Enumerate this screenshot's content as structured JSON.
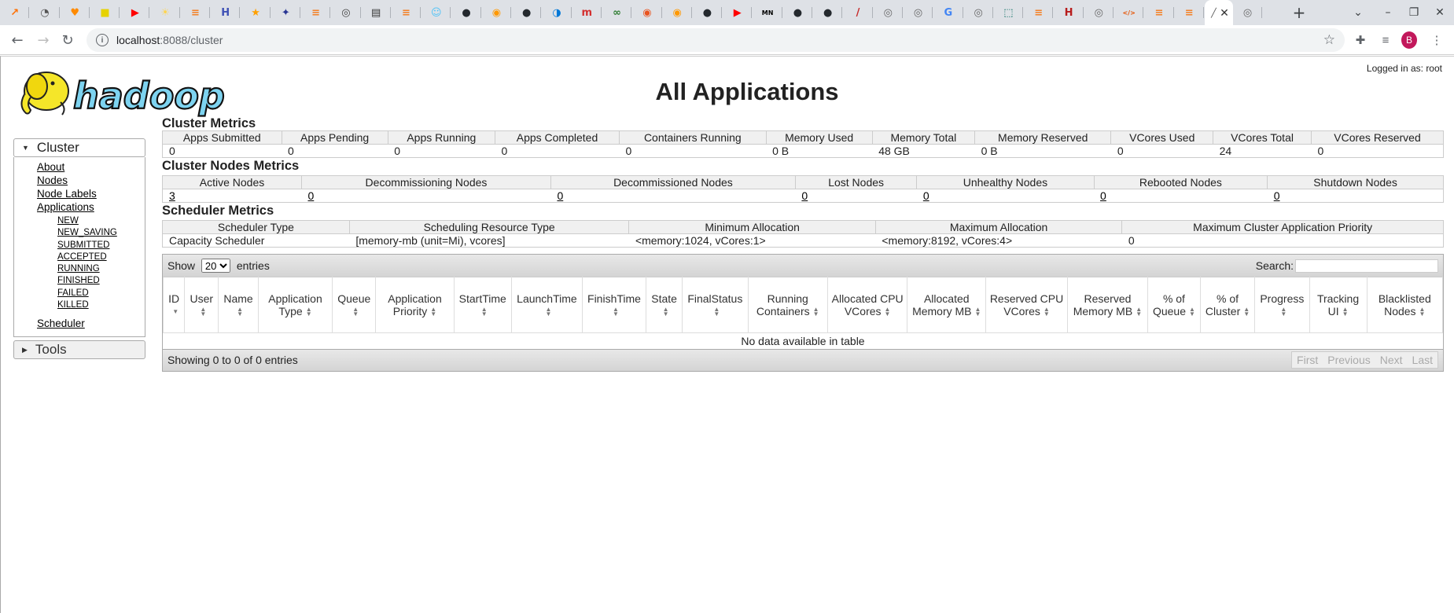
{
  "browser": {
    "tabs": [
      {
        "icon": "hue-icon",
        "color": "#ff6f00",
        "glyph": "↗"
      },
      {
        "icon": "clock-icon",
        "color": "#555555",
        "glyph": "◔"
      },
      {
        "icon": "heart-icon",
        "color": "#ff8a00",
        "glyph": "♥"
      },
      {
        "icon": "yellow-square-icon",
        "color": "#e6d200",
        "glyph": "■"
      },
      {
        "icon": "youtube-icon",
        "color": "#ff0000",
        "glyph": "▶"
      },
      {
        "icon": "bulb-icon",
        "color": "#ffd54f",
        "glyph": "☀"
      },
      {
        "icon": "stackoverflow-icon",
        "color": "#f48024",
        "glyph": "≡"
      },
      {
        "icon": "bracket-icon",
        "color": "#3f51b5",
        "glyph": "H"
      },
      {
        "icon": "trophy-icon",
        "color": "#ffa000",
        "glyph": "★"
      },
      {
        "icon": "grid-icon",
        "color": "#283593",
        "glyph": "✦"
      },
      {
        "icon": "stackoverflow-icon",
        "color": "#f48024",
        "glyph": "≡"
      },
      {
        "icon": "chrome-icon",
        "color": "#444444",
        "glyph": "◎"
      },
      {
        "icon": "doc-icon",
        "color": "#333333",
        "glyph": "▤"
      },
      {
        "icon": "stackoverflow-icon",
        "color": "#f48024",
        "glyph": "≡"
      },
      {
        "icon": "robot-icon",
        "color": "#4fc3f7",
        "glyph": "☺"
      },
      {
        "icon": "github-icon",
        "color": "#24292e",
        "glyph": "●"
      },
      {
        "icon": "chat-icon",
        "color": "#ff9800",
        "glyph": "◉"
      },
      {
        "icon": "github-icon",
        "color": "#24292e",
        "glyph": "●"
      },
      {
        "icon": "edge-icon",
        "color": "#0078d7",
        "glyph": "◑"
      },
      {
        "icon": "m-icon",
        "color": "#d32f2f",
        "glyph": "m"
      },
      {
        "icon": "glasses-icon",
        "color": "#2e7d32",
        "glyph": "∞"
      },
      {
        "icon": "ubuntu-icon",
        "color": "#e95420",
        "glyph": "◉"
      },
      {
        "icon": "chat-icon",
        "color": "#ff9800",
        "glyph": "◉"
      },
      {
        "icon": "github-icon",
        "color": "#24292e",
        "glyph": "●"
      },
      {
        "icon": "youtube-icon",
        "color": "#ff0000",
        "glyph": "▶"
      },
      {
        "icon": "mn-icon",
        "color": "#000000",
        "glyph": "MN"
      },
      {
        "icon": "github-icon",
        "color": "#24292e",
        "glyph": "●"
      },
      {
        "icon": "github-icon",
        "color": "#24292e",
        "glyph": "●"
      },
      {
        "icon": "slash-icon",
        "color": "#c62828",
        "glyph": "/"
      },
      {
        "icon": "globe-icon",
        "color": "#666666",
        "glyph": "◎"
      },
      {
        "icon": "globe-icon",
        "color": "#666666",
        "glyph": "◎"
      },
      {
        "icon": "google-icon",
        "color": "#4285f4",
        "glyph": "G"
      },
      {
        "icon": "globe-icon",
        "color": "#666666",
        "glyph": "◎"
      },
      {
        "icon": "layers-icon",
        "color": "#00695c",
        "glyph": "⬚"
      },
      {
        "icon": "stackoverflow-icon",
        "color": "#f48024",
        "glyph": "≡"
      },
      {
        "icon": "h-icon",
        "color": "#b71c1c",
        "glyph": "H"
      },
      {
        "icon": "globe-icon",
        "color": "#666666",
        "glyph": "◎"
      },
      {
        "icon": "code-icon",
        "color": "#e65100",
        "glyph": "</>"
      },
      {
        "icon": "stackoverflow-icon",
        "color": "#f48024",
        "glyph": "≡"
      },
      {
        "icon": "stackoverflow-icon",
        "color": "#f48024",
        "glyph": "≡"
      }
    ],
    "active_tab": {
      "icon": "hadoop-tab-icon",
      "glyph": "╱"
    },
    "after_active": {
      "icon": "globe-icon",
      "glyph": "◎"
    },
    "url_host": "localhost",
    "url_rest": ":8088/cluster",
    "profile_initial": "B"
  },
  "header": {
    "title": "All Applications",
    "logged_in": "Logged in as: root",
    "logo_text": "hadoop"
  },
  "nav": {
    "cluster_label": "Cluster",
    "cluster_links": [
      "About",
      "Nodes",
      "Node Labels",
      "Applications"
    ],
    "app_states": [
      "NEW",
      "NEW_SAVING",
      "SUBMITTED",
      "ACCEPTED",
      "RUNNING",
      "FINISHED",
      "FAILED",
      "KILLED"
    ],
    "scheduler": "Scheduler",
    "tools_label": "Tools"
  },
  "cluster_metrics": {
    "title": "Cluster Metrics",
    "headers": [
      "Apps Submitted",
      "Apps Pending",
      "Apps Running",
      "Apps Completed",
      "Containers Running",
      "Memory Used",
      "Memory Total",
      "Memory Reserved",
      "VCores Used",
      "VCores Total",
      "VCores Reserved"
    ],
    "values": [
      "0",
      "0",
      "0",
      "0",
      "0",
      "0 B",
      "48 GB",
      "0 B",
      "0",
      "24",
      "0"
    ]
  },
  "node_metrics": {
    "title": "Cluster Nodes Metrics",
    "headers": [
      "Active Nodes",
      "Decommissioning Nodes",
      "Decommissioned Nodes",
      "Lost Nodes",
      "Unhealthy Nodes",
      "Rebooted Nodes",
      "Shutdown Nodes"
    ],
    "values": [
      "3",
      "0",
      "0",
      "0",
      "0",
      "0",
      "0"
    ]
  },
  "scheduler_metrics": {
    "title": "Scheduler Metrics",
    "headers": [
      "Scheduler Type",
      "Scheduling Resource Type",
      "Minimum Allocation",
      "Maximum Allocation",
      "Maximum Cluster Application Priority"
    ],
    "values": [
      "Capacity Scheduler",
      "[memory-mb (unit=Mi), vcores]",
      "<memory:1024, vCores:1>",
      "<memory:8192, vCores:4>",
      "0"
    ]
  },
  "apps_table": {
    "show_label": "Show",
    "entries_label": "entries",
    "page_size": "20",
    "search_label": "Search:",
    "columns": [
      "ID",
      "User",
      "Name",
      "Application Type",
      "Queue",
      "Application Priority",
      "StartTime",
      "LaunchTime",
      "FinishTime",
      "State",
      "FinalStatus",
      "Running Containers",
      "Allocated CPU VCores",
      "Allocated Memory MB",
      "Reserved CPU VCores",
      "Reserved Memory MB",
      "% of Queue",
      "% of Cluster",
      "Progress",
      "Tracking UI",
      "Blacklisted Nodes"
    ],
    "empty_message": "No data available in table",
    "info": "Showing 0 to 0 of 0 entries",
    "pager": [
      "First",
      "Previous",
      "Next",
      "Last"
    ]
  }
}
